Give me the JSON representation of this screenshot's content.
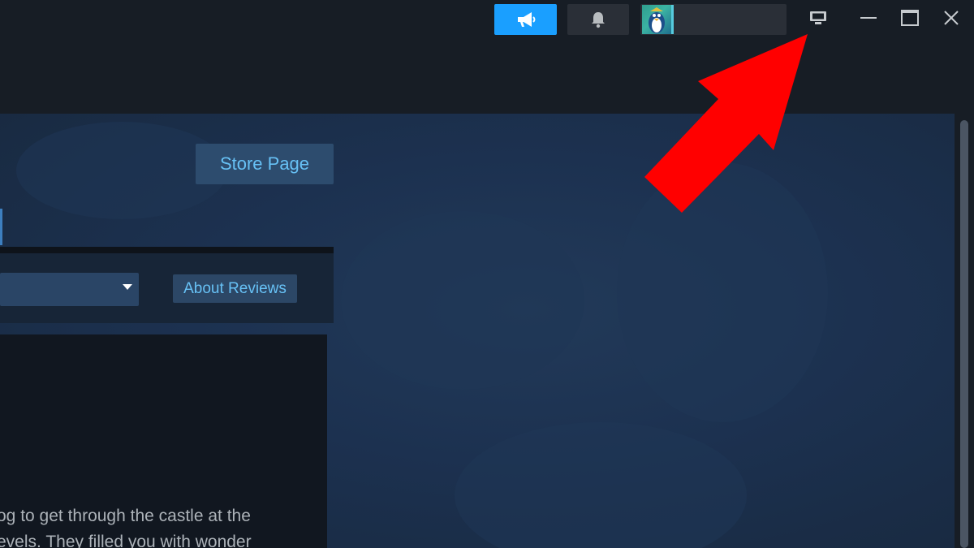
{
  "titlebar": {
    "announcements_icon": "megaphone-icon",
    "notifications_icon": "bell-icon",
    "account": {
      "name": ""
    },
    "window_controls": [
      "big-picture-icon",
      "minimize-icon",
      "maximize-icon",
      "close-icon"
    ]
  },
  "main": {
    "store_page_label": "Store Page",
    "about_reviews_label": "About Reviews",
    "filter_select": {
      "value": ""
    },
    "review_excerpt": [
      "og to get through the castle at the",
      "evels. They filled you with wonder"
    ]
  },
  "overlay": {
    "arrow_color": "#ff0000"
  },
  "colors": {
    "accent": "#1a9fff",
    "link": "#67c1f5",
    "titlebar_bg": "#171d25",
    "content_bg": "#1c3150"
  }
}
